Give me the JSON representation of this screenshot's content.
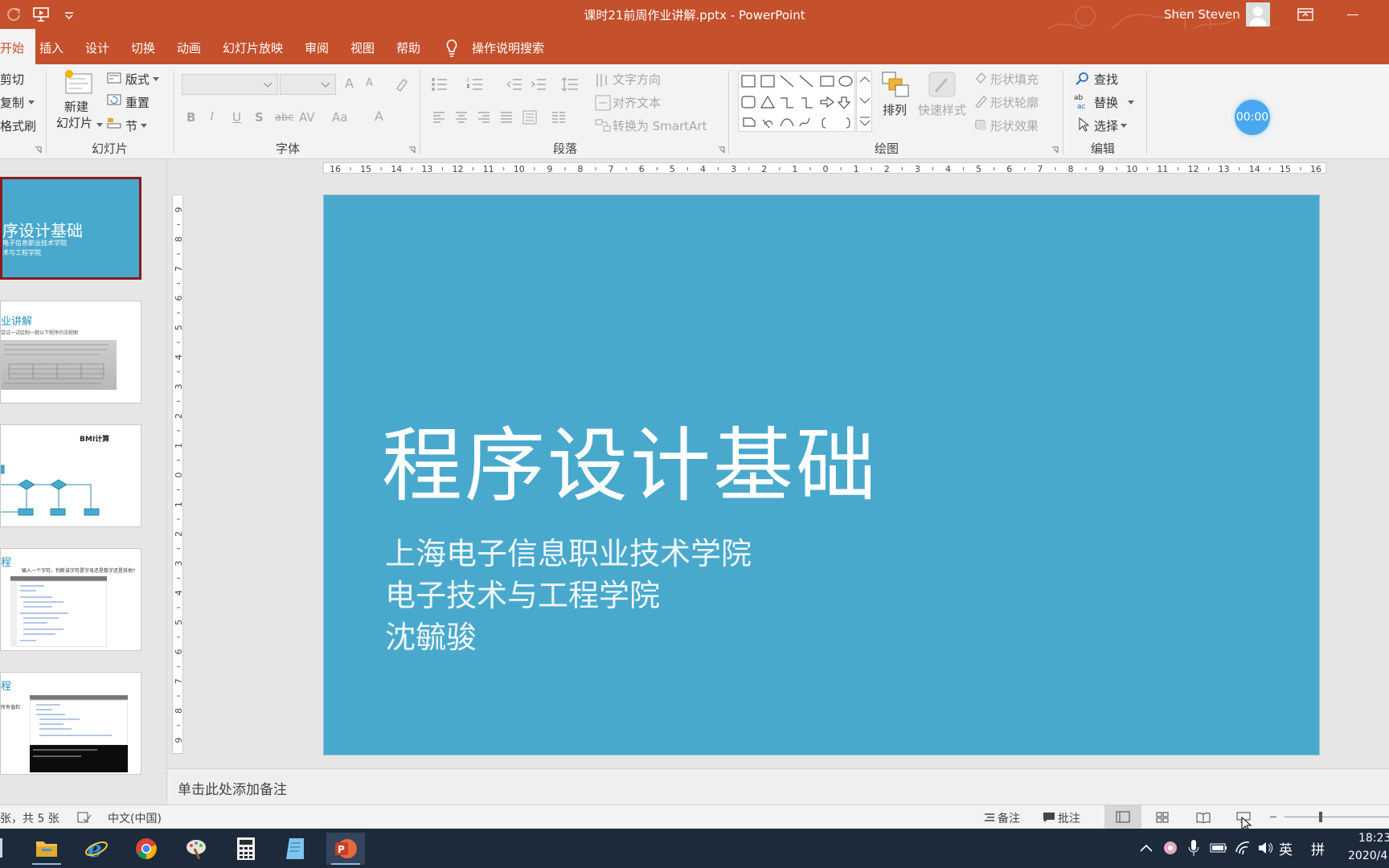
{
  "titlebar": {
    "doc_title": "课时21前周作业讲解.pptx",
    "separator": "-",
    "app_name": "PowerPoint",
    "user_name": "Shen Steven"
  },
  "tabs": [
    "开始",
    "插入",
    "设计",
    "切换",
    "动画",
    "幻灯片放映",
    "审阅",
    "视图",
    "帮助"
  ],
  "tell_me": "操作说明搜索",
  "ribbon": {
    "clipboard": {
      "cut": "剪切",
      "copy": "复制",
      "format_painter": "格式刷"
    },
    "slides": {
      "new_slide_line1": "新建",
      "new_slide_line2": "幻灯片",
      "layout": "版式",
      "reset": "重置",
      "section": "节",
      "group_label": "幻灯片"
    },
    "font": {
      "group_label": "字体",
      "bold": "B",
      "italic": "I",
      "underline": "U",
      "shadow": "S",
      "strike": "abc",
      "spacing": "AV",
      "case": "Aa",
      "color": "A",
      "grow": "A",
      "shrink": "A"
    },
    "paragraph": {
      "group_label": "段落",
      "text_direction": "文字方向",
      "align_text": "对齐文本",
      "smartart": "转换为 SmartArt"
    },
    "drawing": {
      "group_label": "绘图",
      "arrange": "排列",
      "quick_styles": "快速样式",
      "shape_fill": "形状填充",
      "shape_outline": "形状轮廓",
      "shape_effects": "形状效果"
    },
    "editing": {
      "group_label": "编辑",
      "find": "查找",
      "replace": "替换",
      "select": "选择"
    }
  },
  "timer": "00:00",
  "ruler": {
    "h_ticks": [
      "16",
      "15",
      "14",
      "13",
      "12",
      "11",
      "10",
      "9",
      "8",
      "7",
      "6",
      "5",
      "4",
      "3",
      "2",
      "1",
      "0",
      "1",
      "2",
      "3",
      "4",
      "5",
      "6",
      "7",
      "8",
      "9",
      "10",
      "11",
      "12",
      "13",
      "14",
      "15",
      "16"
    ],
    "v_ticks": [
      "9",
      "8",
      "7",
      "6",
      "5",
      "4",
      "3",
      "2",
      "1",
      "0",
      "1",
      "2",
      "3",
      "4",
      "5",
      "6",
      "7",
      "8",
      "9"
    ]
  },
  "thumbnails": [
    {
      "title": "序设计基础",
      "line1": "电子信息职业技术学院",
      "line2": "术与工程学院"
    },
    {
      "title": "业讲解",
      "line1": "尝试一试绘制一题以下程序的流程图"
    },
    {
      "title": "BMI计算"
    },
    {
      "title": "程",
      "line1": "输入一个字符，判断该字符是字母还是数字还是其他?"
    },
    {
      "title": "程",
      "line1": "所有值和"
    }
  ],
  "slide": {
    "title": "程序设计基础",
    "subtitle_1": "上海电子信息职业技术学院",
    "subtitle_2": "电子技术与工程学院",
    "subtitle_3": "沈毓骏",
    "bg_color": "#49a9cc"
  },
  "notes_placeholder": "单击此处添加备注",
  "status": {
    "slide_count": "张，共 5 张",
    "language": "中文(中国)",
    "notes_btn": "备注",
    "comments_btn": "批注"
  },
  "taskbar": {
    "ime_lang": "英",
    "ime_mode": "拼",
    "time": "18:23",
    "date": "2020/4"
  },
  "colors": {
    "accent": "#c4502c",
    "slide_bg": "#49a9cc",
    "taskbar": "#1c2a3c"
  }
}
